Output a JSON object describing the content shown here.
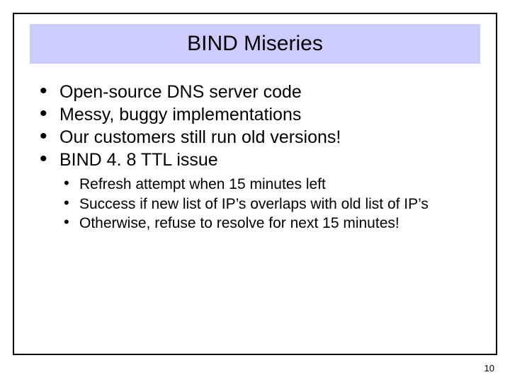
{
  "title": "BIND Miseries",
  "bullets": [
    "Open-source DNS server code",
    "Messy, buggy implementations",
    "Our customers still run old versions!",
    "BIND 4. 8 TTL issue"
  ],
  "sub_bullets": [
    "Refresh attempt when 15 minutes left",
    "Success if new list of IP’s overlaps with old list of IP’s",
    "Otherwise, refuse to resolve for next 15 minutes!"
  ],
  "page_number": "10"
}
